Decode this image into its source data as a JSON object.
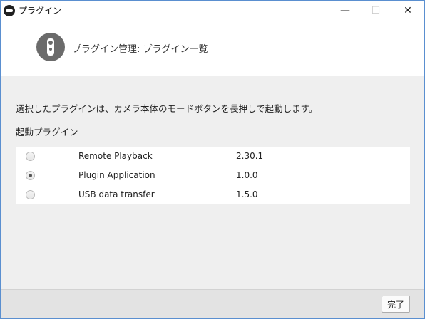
{
  "window": {
    "title": "プラグイン",
    "minimize_glyph": "—",
    "maximize_glyph": "☐",
    "close_glyph": "✕"
  },
  "header": {
    "icon": "plugin-camera-icon",
    "title": "プラグイン管理: プラグイン一覧"
  },
  "main": {
    "description": "選択したプラグインは、カメラ本体のモードボタンを長押しで起動します。",
    "section_label": "起動プラグイン",
    "plugins": [
      {
        "name": "Remote Playback",
        "version": "2.30.1",
        "selected": false
      },
      {
        "name": "Plugin Application",
        "version": "1.0.0",
        "selected": true
      },
      {
        "name": "USB data transfer",
        "version": "1.5.0",
        "selected": false
      }
    ]
  },
  "footer": {
    "done_label": "完了"
  },
  "colors": {
    "accent_border": "#5a8fd0",
    "header_bg": "#ffffff",
    "content_bg": "#efefef",
    "badge": "#6b6b6b"
  }
}
